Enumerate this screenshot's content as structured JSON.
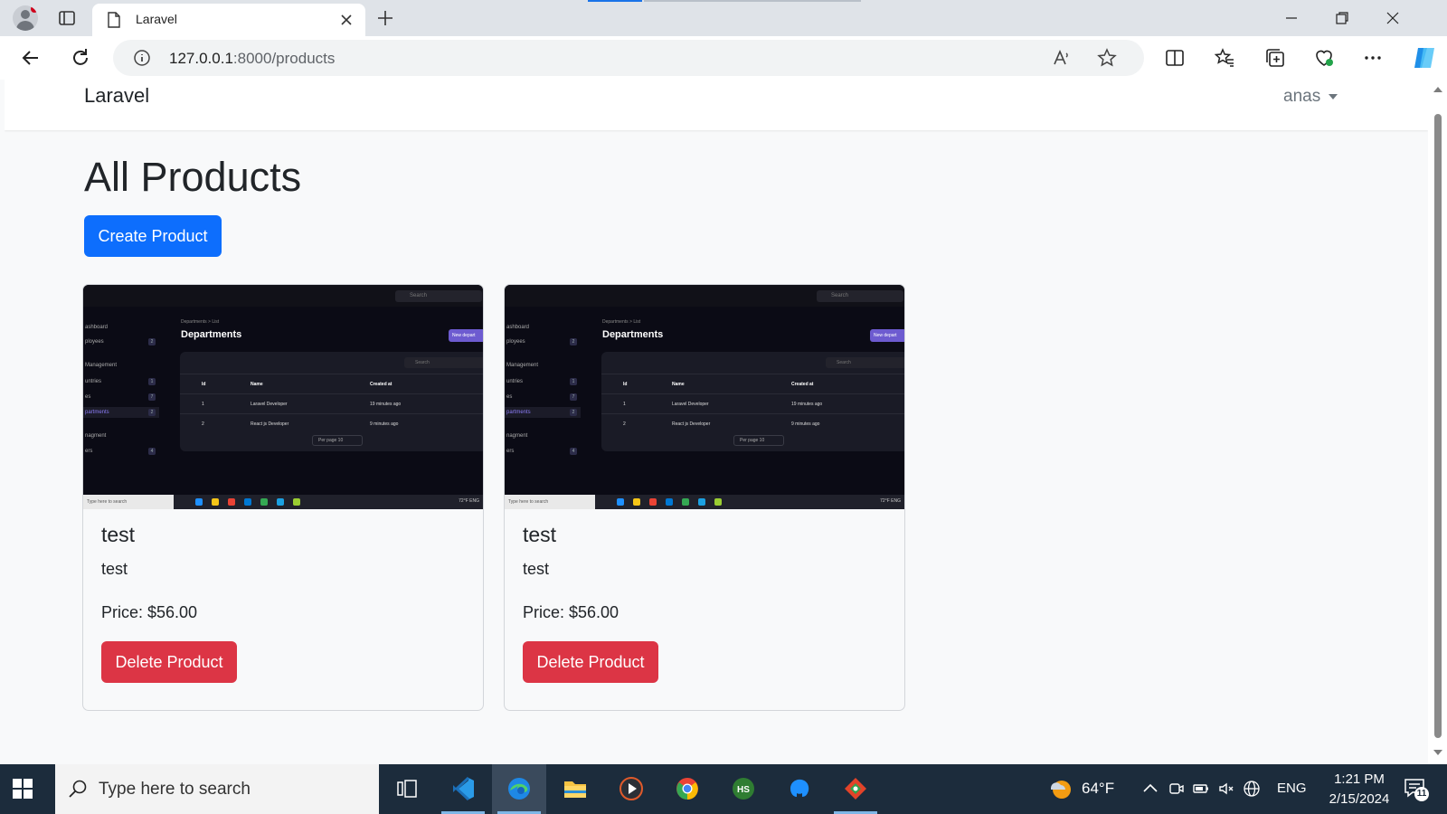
{
  "browser": {
    "tab_title": "Laravel",
    "url_host": "127.0.0.1",
    "url_path": ":8000/products"
  },
  "navbar": {
    "brand": "Laravel",
    "user": "anas"
  },
  "main": {
    "heading": "All Products",
    "create_button": "Create Product"
  },
  "products": [
    {
      "title": "test",
      "description": "test",
      "price": "Price: $56.00",
      "delete_label": "Delete Product"
    },
    {
      "title": "test",
      "description": "test",
      "price": "Price: $56.00",
      "delete_label": "Delete Product"
    }
  ],
  "thumbnail": {
    "search": "Search",
    "crumb": "Departments  >  List",
    "heading": "Departments",
    "new_button": "New depart",
    "sidebar": [
      "ashboard",
      "ployees",
      "Management",
      "untries",
      "es",
      "partments",
      "nagment",
      "ers"
    ],
    "columns": [
      "Id",
      "Name",
      "Created at"
    ],
    "rows": [
      [
        "1",
        "Laravel Developer",
        "19 minutes ago"
      ],
      [
        "2",
        "React js Developer",
        "9 minutes ago"
      ]
    ],
    "per_page": "Per page    10",
    "taskbar_search": "Type here to search",
    "taskbar_tray": "72°F  ENG"
  },
  "taskbar": {
    "search_placeholder": "Type here to search",
    "weather": "64°F",
    "language": "ENG",
    "time": "1:21 PM",
    "date": "2/15/2024",
    "notifications": "11"
  },
  "colors": {
    "primary": "#0d6efd",
    "danger": "#dc3545",
    "taskbar": "#1c2c3c"
  }
}
